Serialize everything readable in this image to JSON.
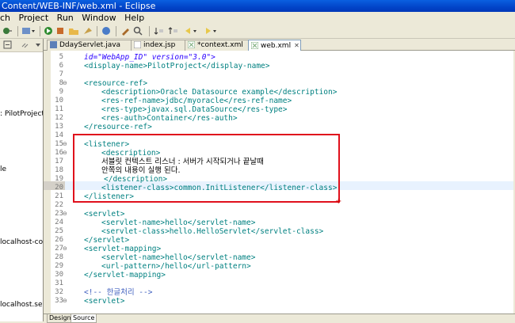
{
  "window": {
    "title": "Content/WEB-INF/web.xml - Eclipse"
  },
  "menu": [
    "ch",
    "Project",
    "Run",
    "Window",
    "Help"
  ],
  "left_panel": {
    "items": [
      ": PilotProject",
      "le",
      "localhost-cor",
      "localhost.ser"
    ]
  },
  "tabs": [
    {
      "label": "DdayServlet.java",
      "active": false
    },
    {
      "label": "index.jsp",
      "active": false
    },
    {
      "label": "*context.xml",
      "active": false
    },
    {
      "label": "web.xml",
      "active": true,
      "close": "✕"
    }
  ],
  "editor": {
    "lines": [
      {
        "num": "5",
        "text": "id=\"WebApp_ID\" version=\"3.0\">"
      },
      {
        "num": "6",
        "text": "<display-name>PilotProject</display-name>"
      },
      {
        "num": "7",
        "text": ""
      },
      {
        "num": "8",
        "text": "<resource-ref>"
      },
      {
        "num": "9",
        "text": "<description>Oracle Datasource example</description>"
      },
      {
        "num": "10",
        "text": "<res-ref-name>jdbc/myoracle</res-ref-name>"
      },
      {
        "num": "11",
        "text": "<res-type>javax.sql.DataSource</res-type>"
      },
      {
        "num": "12",
        "text": "<res-auth>Container</res-auth>"
      },
      {
        "num": "13",
        "text": "</resource-ref>"
      },
      {
        "num": "14",
        "text": ""
      },
      {
        "num": "15",
        "text": "<listener>"
      },
      {
        "num": "16",
        "text": "<description>"
      },
      {
        "num": "17",
        "text": "서블릿 컨텍스트 리스너 : 서버가 시작되거나 끝날때"
      },
      {
        "num": "18",
        "text": "안쪽의 내용이 실행 된다."
      },
      {
        "num": "19",
        "text": "</description>"
      },
      {
        "num": "20",
        "text": "<listener-class>common.InitListener</listener-class>"
      },
      {
        "num": "21",
        "text": "</listener>"
      },
      {
        "num": "22",
        "text": ""
      },
      {
        "num": "23",
        "text": "<servlet>"
      },
      {
        "num": "24",
        "text": "<servlet-name>hello</servlet-name>"
      },
      {
        "num": "25",
        "text": "<servlet-class>hello.HelloServlet</servlet-class>"
      },
      {
        "num": "26",
        "text": "</servlet>"
      },
      {
        "num": "27",
        "text": "<servlet-mapping>"
      },
      {
        "num": "28",
        "text": "<servlet-name>hello</servlet-name>"
      },
      {
        "num": "29",
        "text": "<url-pattern>/hello</url-pattern>"
      },
      {
        "num": "30",
        "text": "</servlet-mapping>"
      },
      {
        "num": "31",
        "text": ""
      },
      {
        "num": "32",
        "text": "<!-- 한글처리 -->"
      },
      {
        "num": "33",
        "text": "<servlet>"
      }
    ]
  },
  "bottom_tabs": [
    "Design",
    "Source"
  ],
  "colors": {
    "highlight_box": "#e0101c",
    "tag": "#008080",
    "comment": "#3f5fbf"
  }
}
